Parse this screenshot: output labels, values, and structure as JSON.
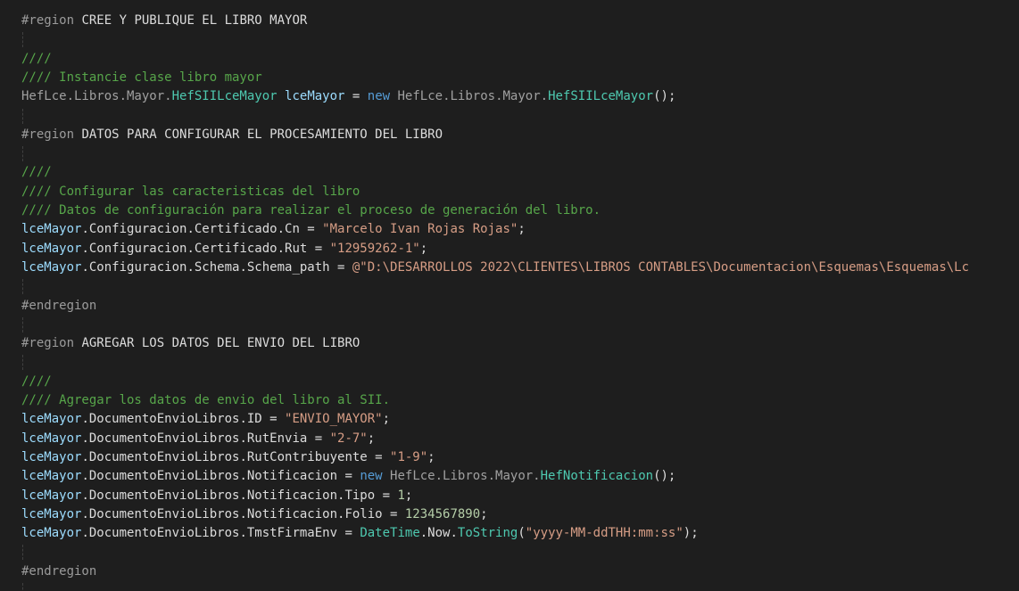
{
  "editor": {
    "lines": [
      [
        {
          "t": "#region ",
          "c": "pre"
        },
        {
          "t": "CREE Y PUBLIQUE EL LIBRO MAYOR",
          "c": "txt"
        }
      ],
      [],
      [
        {
          "t": "////",
          "c": "cm"
        }
      ],
      [
        {
          "t": "//// Instancie clase libro mayor",
          "c": "cm"
        }
      ],
      [
        {
          "t": "HefLce.Libros.Mayor.",
          "c": "ns"
        },
        {
          "t": "HefSIILceMayor",
          "c": "ty"
        },
        {
          "t": " ",
          "c": "txt"
        },
        {
          "t": "lceMayor",
          "c": "var"
        },
        {
          "t": " = ",
          "c": "txt"
        },
        {
          "t": "new",
          "c": "kw"
        },
        {
          "t": " HefLce.Libros.Mayor.",
          "c": "ns"
        },
        {
          "t": "HefSIILceMayor",
          "c": "ty"
        },
        {
          "t": "();",
          "c": "txt"
        }
      ],
      [],
      [
        {
          "t": "#region ",
          "c": "pre"
        },
        {
          "t": "DATOS PARA CONFIGURAR EL PROCESAMIENTO DEL LIBRO",
          "c": "txt"
        }
      ],
      [],
      [
        {
          "t": "////",
          "c": "cm"
        }
      ],
      [
        {
          "t": "//// Configurar las caracteristicas del libro",
          "c": "cm"
        }
      ],
      [
        {
          "t": "//// Datos de configuración para realizar el proceso de generación del libro.",
          "c": "cm"
        }
      ],
      [
        {
          "t": "lceMayor",
          "c": "var"
        },
        {
          "t": ".Configuracion.Certificado.Cn = ",
          "c": "txt"
        },
        {
          "t": "\"Marcelo Ivan Rojas Rojas\"",
          "c": "str"
        },
        {
          "t": ";",
          "c": "txt"
        }
      ],
      [
        {
          "t": "lceMayor",
          "c": "var"
        },
        {
          "t": ".Configuracion.Certificado.Rut = ",
          "c": "txt"
        },
        {
          "t": "\"12959262-1\"",
          "c": "str"
        },
        {
          "t": ";",
          "c": "txt"
        }
      ],
      [
        {
          "t": "lceMayor",
          "c": "var"
        },
        {
          "t": ".Configuracion.Schema.Schema_path = ",
          "c": "txt"
        },
        {
          "t": "@\"D:\\DESARROLLOS 2022\\CLIENTES\\LIBROS CONTABLES\\Documentacion\\Esquemas\\Esquemas\\Lc",
          "c": "str"
        }
      ],
      [],
      [
        {
          "t": "#endregion",
          "c": "pre"
        }
      ],
      [],
      [
        {
          "t": "#region ",
          "c": "pre"
        },
        {
          "t": "AGREGAR LOS DATOS DEL ENVIO DEL LIBRO",
          "c": "txt"
        }
      ],
      [],
      [
        {
          "t": "////",
          "c": "cm"
        }
      ],
      [
        {
          "t": "//// Agregar los datos de envio del libro al SII.",
          "c": "cm"
        }
      ],
      [
        {
          "t": "lceMayor",
          "c": "var"
        },
        {
          "t": ".DocumentoEnvioLibros.ID = ",
          "c": "txt"
        },
        {
          "t": "\"ENVIO_MAYOR\"",
          "c": "str"
        },
        {
          "t": ";",
          "c": "txt"
        }
      ],
      [
        {
          "t": "lceMayor",
          "c": "var"
        },
        {
          "t": ".DocumentoEnvioLibros.RutEnvia = ",
          "c": "txt"
        },
        {
          "t": "\"2-7\"",
          "c": "str"
        },
        {
          "t": ";",
          "c": "txt"
        }
      ],
      [
        {
          "t": "lceMayor",
          "c": "var"
        },
        {
          "t": ".DocumentoEnvioLibros.RutContribuyente = ",
          "c": "txt"
        },
        {
          "t": "\"1-9\"",
          "c": "str"
        },
        {
          "t": ";",
          "c": "txt"
        }
      ],
      [
        {
          "t": "lceMayor",
          "c": "var"
        },
        {
          "t": ".DocumentoEnvioLibros.Notificacion = ",
          "c": "txt"
        },
        {
          "t": "new",
          "c": "kw"
        },
        {
          "t": " HefLce.Libros.Mayor.",
          "c": "ns"
        },
        {
          "t": "HefNotificacion",
          "c": "ty"
        },
        {
          "t": "();",
          "c": "txt"
        }
      ],
      [
        {
          "t": "lceMayor",
          "c": "var"
        },
        {
          "t": ".DocumentoEnvioLibros.Notificacion.Tipo = ",
          "c": "txt"
        },
        {
          "t": "1",
          "c": "num"
        },
        {
          "t": ";",
          "c": "txt"
        }
      ],
      [
        {
          "t": "lceMayor",
          "c": "var"
        },
        {
          "t": ".DocumentoEnvioLibros.Notificacion.Folio = ",
          "c": "txt"
        },
        {
          "t": "1234567890",
          "c": "num"
        },
        {
          "t": ";",
          "c": "txt"
        }
      ],
      [
        {
          "t": "lceMayor",
          "c": "var"
        },
        {
          "t": ".DocumentoEnvioLibros.TmstFirmaEnv = ",
          "c": "txt"
        },
        {
          "t": "DateTime",
          "c": "ty"
        },
        {
          "t": ".Now.",
          "c": "txt"
        },
        {
          "t": "ToString",
          "c": "ty"
        },
        {
          "t": "(",
          "c": "txt"
        },
        {
          "t": "\"yyyy-MM-ddTHH:mm:ss\"",
          "c": "str"
        },
        {
          "t": ");",
          "c": "txt"
        }
      ],
      [],
      [
        {
          "t": "#endregion",
          "c": "pre"
        }
      ],
      []
    ],
    "colors": {
      "background": "#1e1e1e",
      "keyword": "#569cd6",
      "type": "#4ec9b0",
      "string": "#d69d85",
      "comment": "#57a64a",
      "variable": "#9cdcfe"
    }
  }
}
